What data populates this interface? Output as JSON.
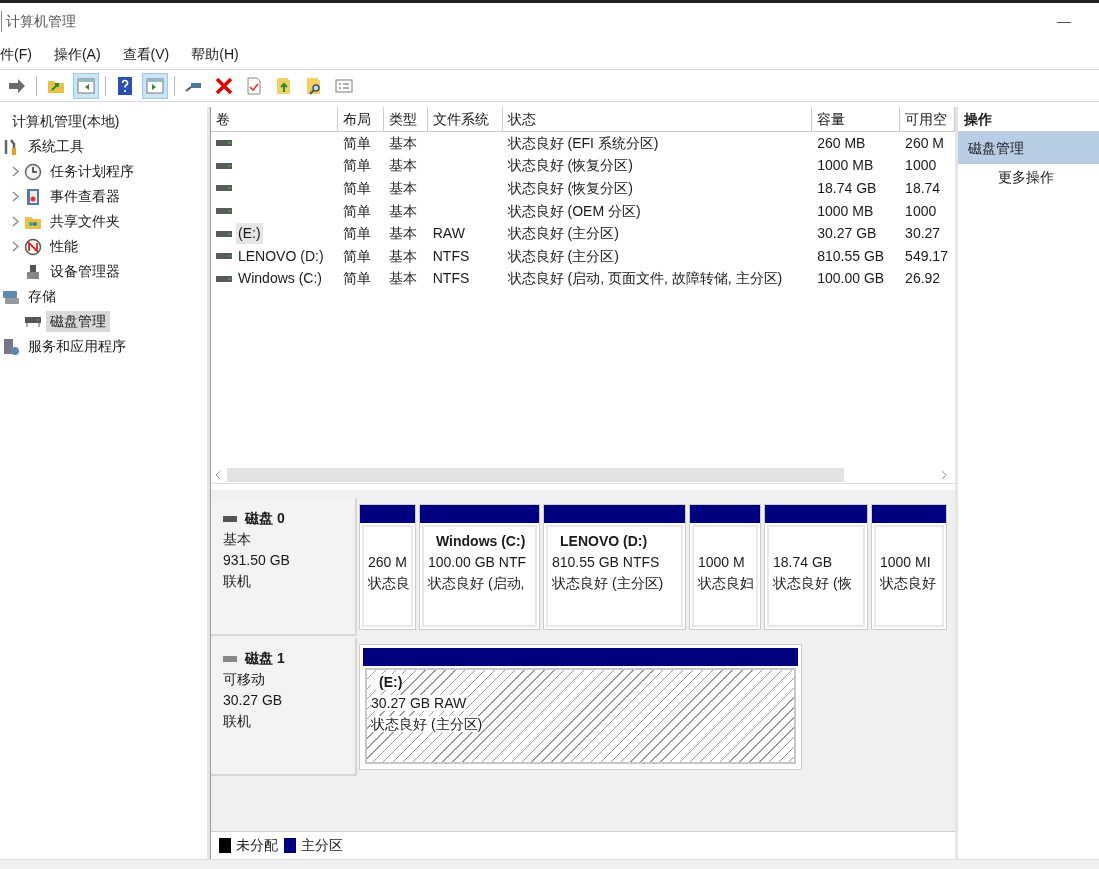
{
  "window": {
    "title": "计算机管理",
    "minimize": "—"
  },
  "menu": [
    "件(F)",
    "操作(A)",
    "查看(V)",
    "帮助(H)"
  ],
  "toolbar": [
    {
      "kind": "forward",
      "pressed": false
    },
    {
      "kind": "sep"
    },
    {
      "kind": "up",
      "pressed": false
    },
    {
      "kind": "tree",
      "pressed": true
    },
    {
      "kind": "sep"
    },
    {
      "kind": "help",
      "pressed": false
    },
    {
      "kind": "panel",
      "pressed": true
    },
    {
      "kind": "sep"
    },
    {
      "kind": "connect",
      "pressed": false
    },
    {
      "kind": "delete",
      "pressed": false
    },
    {
      "kind": "props",
      "pressed": false
    },
    {
      "kind": "folderup",
      "pressed": false
    },
    {
      "kind": "find",
      "pressed": false
    },
    {
      "kind": "list",
      "pressed": false
    }
  ],
  "tree": [
    {
      "label": "计算机管理(本地)",
      "selected": false,
      "children": [
        {
          "label": "系统工具",
          "selected": false,
          "children": [
            {
              "label": "任务计划程序",
              "chevron": true,
              "selected": false
            },
            {
              "label": "事件查看器",
              "chevron": true,
              "selected": false
            },
            {
              "label": "共享文件夹",
              "chevron": true,
              "selected": false
            },
            {
              "label": "性能",
              "chevron": true,
              "selected": false
            },
            {
              "label": "设备管理器",
              "chevron": false,
              "selected": false
            }
          ]
        },
        {
          "label": "存储",
          "selected": false,
          "children": [
            {
              "label": "磁盘管理",
              "chevron": false,
              "selected": true
            }
          ]
        },
        {
          "label": "服务和应用程序",
          "selected": false
        }
      ]
    }
  ],
  "table": {
    "columns": [
      "卷",
      "布局",
      "类型",
      "文件系统",
      "状态",
      "容量",
      "可用空"
    ],
    "rows": [
      {
        "layout": "简单",
        "type": "基本",
        "status": "状态良好 (EFI 系统分区)",
        "capacity": "260 MB",
        "free": "260 M"
      },
      {
        "layout": "简单",
        "type": "基本",
        "status": "状态良好 (恢复分区)",
        "capacity": "1000 MB",
        "free": "1000"
      },
      {
        "layout": "简单",
        "type": "基本",
        "status": "状态良好 (恢复分区)",
        "capacity": "18.74 GB",
        "free": "18.74"
      },
      {
        "layout": "简单",
        "type": "基本",
        "status": "状态良好 (OEM 分区)",
        "capacity": "1000 MB",
        "free": "1000"
      },
      {
        "volume": "(E:)",
        "layout": "简单",
        "type": "基本",
        "fs": "RAW",
        "status": "状态良好 (主分区)",
        "capacity": "30.27 GB",
        "free": "30.27",
        "selected": true
      },
      {
        "volume": "LENOVO (D:)",
        "layout": "简单",
        "type": "基本",
        "fs": "NTFS",
        "status": "状态良好 (主分区)",
        "capacity": "810.55 GB",
        "free": "549.17",
        "selected": false
      },
      {
        "volume": "Windows (C:)",
        "layout": "简单",
        "type": "基本",
        "fs": "NTFS",
        "status": "状态良好 (启动, 页面文件, 故障转储, 主分区)",
        "capacity": "100.00 GB",
        "free": "26.92",
        "selected": false
      }
    ]
  },
  "actions": {
    "title": "操作",
    "section": "磁盘管理",
    "items": [
      "更多操作"
    ]
  },
  "disks": [
    {
      "name": "磁盘 0",
      "type": "基本",
      "size": "931.50 GB",
      "state": "联机",
      "partitions": [
        {
          "size": "260 M",
          "status": "状态良",
          "selected": false
        },
        {
          "label": "Windows (C:)",
          "size": "100.00 GB NTF",
          "status": "状态良好 (启动,",
          "selected": false
        },
        {
          "label": "LENOVO (D:)",
          "size": "810.55 GB NTFS",
          "status": "状态良好 (主分区)",
          "selected": false
        },
        {
          "size": "1000 M",
          "status": "状态良妇",
          "selected": false
        },
        {
          "size": "18.74 GB",
          "status": "状态良好 (恢",
          "selected": false
        },
        {
          "size": "1000 MI",
          "status": "状态良好",
          "selected": false
        }
      ]
    },
    {
      "name": "磁盘 1",
      "type": "可移动",
      "size": "30.27 GB",
      "state": "联机",
      "partitions": [
        {
          "label": "(E:)",
          "size": "30.27 GB RAW",
          "status": "状态良好 (主分区)",
          "selected": true
        }
      ]
    }
  ],
  "legend": [
    {
      "label": "未分配",
      "color": "#000000"
    },
    {
      "label": "主分区",
      "color": "#000080"
    }
  ]
}
